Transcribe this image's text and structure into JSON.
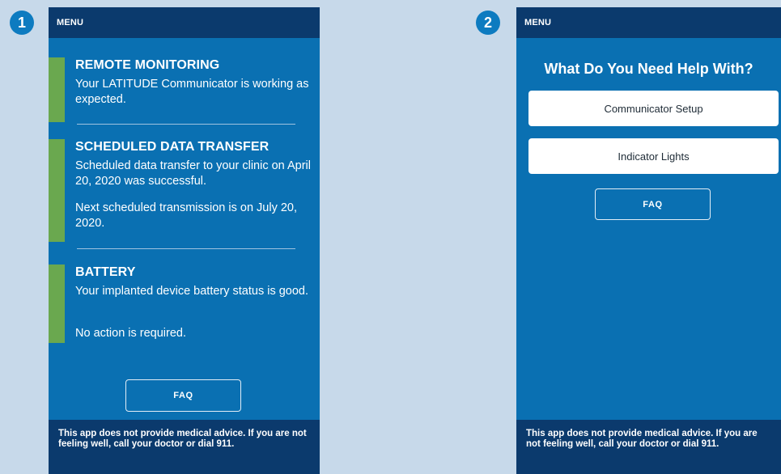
{
  "badges": {
    "left": "1",
    "right": "2"
  },
  "left_screen": {
    "menu": "MENU",
    "sections": [
      {
        "heading": "REMOTE MONITORING",
        "lines": [
          "Your LATITUDE Communicator is working as expected."
        ]
      },
      {
        "heading": "SCHEDULED DATA TRANSFER",
        "lines": [
          "Scheduled data transfer to your clinic on April 20, 2020 was successful.",
          "Next scheduled transmission is on July 20, 2020."
        ]
      },
      {
        "heading": "BATTERY",
        "lines": [
          "Your implanted device battery status is good.",
          "No action is required."
        ]
      }
    ],
    "faq": "FAQ",
    "footer": "This app does not provide medical advice. If you are not feeling well, call your doctor or dial 911."
  },
  "right_screen": {
    "menu": "MENU",
    "title": "What Do You Need Help With?",
    "buttons": [
      "Communicator Setup",
      "Indicator Lights"
    ],
    "faq": "FAQ",
    "footer": "This app does not provide medical advice. If you are not feeling well, call your doctor or dial 911."
  },
  "colors": {
    "screen_bg": "#0a70b2",
    "header_bg": "#0b3a6d",
    "status_ok": "#6aa84f",
    "page_bg": "#c7d9ea"
  }
}
